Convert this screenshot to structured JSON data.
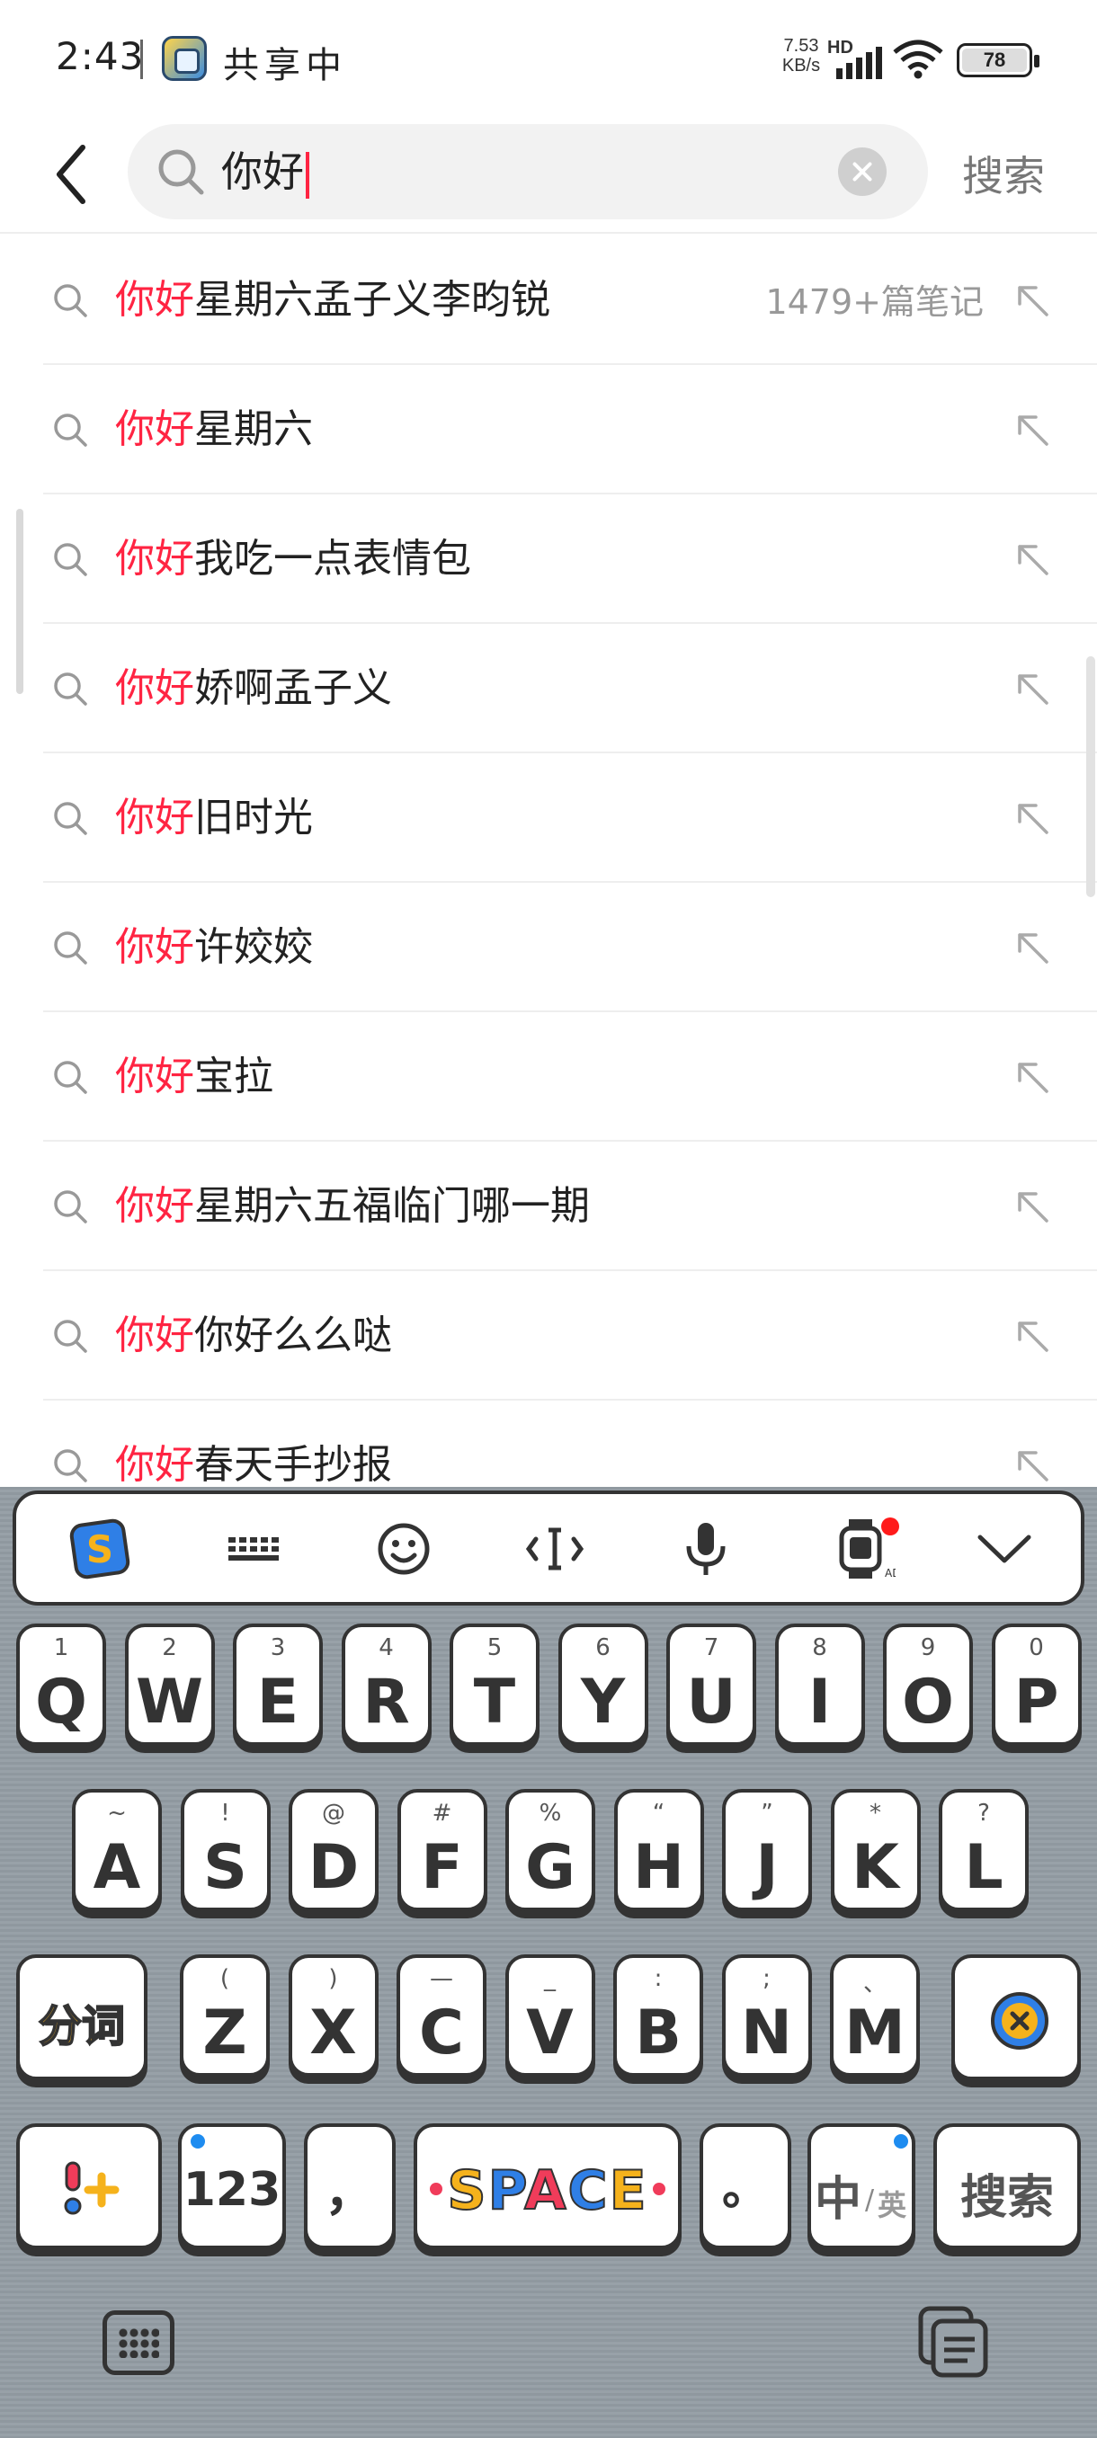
{
  "status_bar": {
    "time": "2:43",
    "sharing_label": "共享中",
    "net_speed_value": "7.53",
    "net_speed_unit": "KB/s",
    "network_type": "HD",
    "battery": "78"
  },
  "search": {
    "query": "你好",
    "submit_label": "搜索"
  },
  "suggestions": [
    {
      "highlight": "你好",
      "rest": "星期六孟子义李昀锐",
      "count": "1479+篇笔记"
    },
    {
      "highlight": "你好",
      "rest": "星期六",
      "count": ""
    },
    {
      "highlight": "你好",
      "rest": "我吃一点表情包",
      "count": ""
    },
    {
      "highlight": "你好",
      "rest": "娇啊孟子义",
      "count": ""
    },
    {
      "highlight": "你好",
      "rest": "旧时光",
      "count": ""
    },
    {
      "highlight": "你好",
      "rest": "许姣姣",
      "count": ""
    },
    {
      "highlight": "你好",
      "rest": "宝拉",
      "count": ""
    },
    {
      "highlight": "你好",
      "rest": "星期六五福临门哪一期",
      "count": ""
    },
    {
      "highlight": "你好",
      "rest": "你好么么哒",
      "count": ""
    },
    {
      "highlight": "你好",
      "rest": "春天手抄报",
      "count": ""
    }
  ],
  "keyboard": {
    "row1": [
      {
        "hint": "1",
        "key": "Q"
      },
      {
        "hint": "2",
        "key": "W"
      },
      {
        "hint": "3",
        "key": "E"
      },
      {
        "hint": "4",
        "key": "R"
      },
      {
        "hint": "5",
        "key": "T"
      },
      {
        "hint": "6",
        "key": "Y"
      },
      {
        "hint": "7",
        "key": "U"
      },
      {
        "hint": "8",
        "key": "I"
      },
      {
        "hint": "9",
        "key": "O"
      },
      {
        "hint": "0",
        "key": "P"
      }
    ],
    "row2": [
      {
        "hint": "~",
        "key": "A"
      },
      {
        "hint": "!",
        "key": "S"
      },
      {
        "hint": "@",
        "key": "D"
      },
      {
        "hint": "#",
        "key": "F"
      },
      {
        "hint": "%",
        "key": "G"
      },
      {
        "hint": "“",
        "key": "H"
      },
      {
        "hint": "”",
        "key": "J"
      },
      {
        "hint": "*",
        "key": "K"
      },
      {
        "hint": "?",
        "key": "L"
      }
    ],
    "row3": [
      {
        "hint": "(",
        "key": "Z"
      },
      {
        "hint": ")",
        "key": "X"
      },
      {
        "hint": "—",
        "key": "C"
      },
      {
        "hint": "_",
        "key": "V"
      },
      {
        "hint": ":",
        "key": "B"
      },
      {
        "hint": ";",
        "key": "N"
      },
      {
        "hint": "、",
        "key": "M"
      }
    ],
    "segment_label": "分词",
    "num_label": "123",
    "comma_label": "，",
    "space_label": "SPACE",
    "period_label": "。",
    "lang_main": "中",
    "lang_alt": "英",
    "enter_label": "搜索",
    "colors": {
      "space_letters": [
        "#f5b21c",
        "#2f7fe6",
        "#f03c5a",
        "#2f7fe6",
        "#f5b21c"
      ],
      "accent_red": "#ff2442"
    }
  }
}
